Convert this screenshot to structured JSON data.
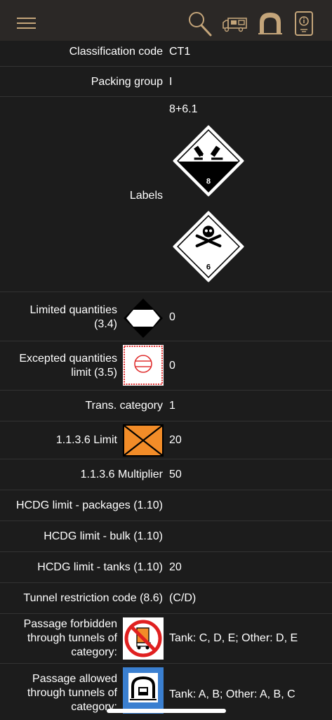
{
  "header": {
    "icons": [
      "menu-icon",
      "search-icon",
      "truck-icon",
      "tunnel-icon",
      "info-book-icon"
    ],
    "accent_color": "#c4a57a"
  },
  "rows": {
    "classification": {
      "label": "Classification code",
      "value": "CT1"
    },
    "packing_group": {
      "label": "Packing group",
      "value": "I"
    },
    "labels": {
      "label": "Labels",
      "value": "8+6.1",
      "label_numbers": [
        "8",
        "6"
      ]
    },
    "limited_qty": {
      "label_line1": "Limited quantities",
      "label_line2": "(3.4)",
      "value": "0"
    },
    "excepted_qty": {
      "label_line1": "Excepted quantities",
      "label_line2": "limit (3.5)",
      "value": "0"
    },
    "trans_category": {
      "label": "Trans. category",
      "value": "1"
    },
    "limit_1136": {
      "label": "1.1.3.6 Limit",
      "value": "20"
    },
    "multiplier_1136": {
      "label": "1.1.3.6 Multiplier",
      "value": "50"
    },
    "hcdg_packages": {
      "label": "HCDG limit - packages (1.10)",
      "value": ""
    },
    "hcdg_bulk": {
      "label": "HCDG limit - bulk (1.10)",
      "value": ""
    },
    "hcdg_tanks": {
      "label": "HCDG limit - tanks (1.10)",
      "value": "20"
    },
    "tunnel_code": {
      "label": "Tunnel restriction code (8.6)",
      "value": "(C/D)"
    },
    "passage_forbidden": {
      "label_line1": "Passage forbidden",
      "label_line2": "through tunnels of",
      "label_line3": "category:",
      "value": "Tank: C, D, E; Other: D, E"
    },
    "passage_allowed": {
      "label_line1": "Passage allowed",
      "label_line2": "through tunnels of",
      "label_line3": "category:",
      "value": "Tank: A, B; Other: A, B, C"
    }
  }
}
